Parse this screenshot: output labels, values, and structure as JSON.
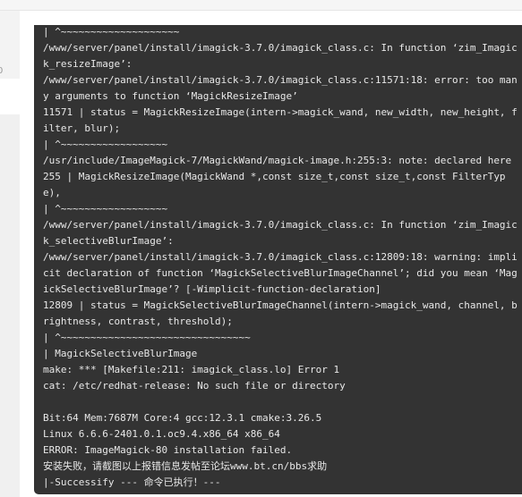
{
  "sidebar": {
    "partial_glyph": "0"
  },
  "terminal": {
    "lines": [
      "| ^~~~~~~~~~~~~~~~~~~~~",
      "/www/server/panel/install/imagick-3.7.0/imagick_class.c: In function ‘zim_Imagick_resizeImage’:",
      "/www/server/panel/install/imagick-3.7.0/imagick_class.c:11571:18: error: too many arguments to function ‘MagickResizeImage’",
      "11571 | status = MagickResizeImage(intern->magick_wand, new_width, new_height, filter, blur);",
      "| ^~~~~~~~~~~~~~~~~~~",
      "/usr/include/ImageMagick-7/MagickWand/magick-image.h:255:3: note: declared here",
      "255 | MagickResizeImage(MagickWand *,const size_t,const size_t,const FilterType),",
      "| ^~~~~~~~~~~~~~~~~~~",
      "/www/server/panel/install/imagick-3.7.0/imagick_class.c: In function ‘zim_Imagick_selectiveBlurImage’:",
      "/www/server/panel/install/imagick-3.7.0/imagick_class.c:12809:18: warning: implicit declaration of function ‘MagickSelectiveBlurImageChannel’; did you mean ‘MagickSelectiveBlurImage’? [-Wimplicit-function-declaration]",
      "12809 | status = MagickSelectiveBlurImageChannel(intern->magick_wand, channel, brightness, contrast, threshold);",
      "| ^~~~~~~~~~~~~~~~~~~~~~~~~~~~~~~~~",
      "| MagickSelectiveBlurImage",
      "make: *** [Makefile:211: imagick_class.lo] Error 1",
      "cat: /etc/redhat-release: No such file or directory",
      "",
      "Bit:64 Mem:7687M Core:4 gcc:12.3.1 cmake:3.26.5",
      "Linux 6.6.6-2401.0.1.oc9.4.x86_64 x86_64",
      "ERROR: ImageMagick-80 installation failed.",
      "安装失败，请截图以上报错信息发帖至论坛www.bt.cn/bbs求助",
      "|-Successify --- 命令已执行！---"
    ]
  }
}
